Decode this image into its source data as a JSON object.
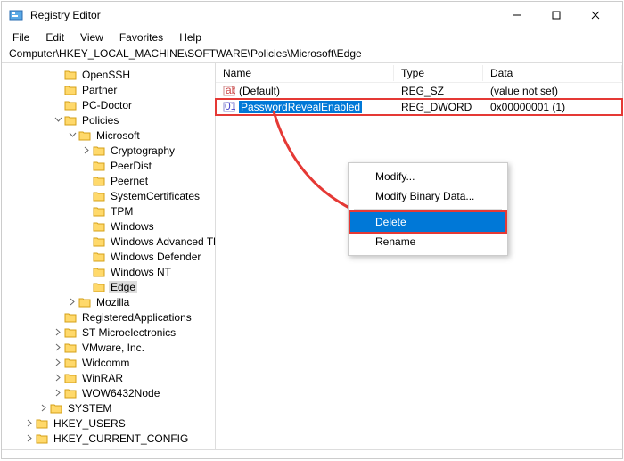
{
  "window": {
    "title": "Registry Editor"
  },
  "menu": {
    "file": "File",
    "edit": "Edit",
    "view": "View",
    "favorites": "Favorites",
    "help": "Help"
  },
  "address": "Computer\\HKEY_LOCAL_MACHINE\\SOFTWARE\\Policies\\Microsoft\\Edge",
  "tree": {
    "openssh": "OpenSSH",
    "partner": "Partner",
    "pcdoctor": "PC-Doctor",
    "policies": "Policies",
    "microsoft": "Microsoft",
    "cryptography": "Cryptography",
    "peerdist": "PeerDist",
    "peernet": "Peernet",
    "systemcertificates": "SystemCertificates",
    "tpm": "TPM",
    "windows": "Windows",
    "windows_advanced": "Windows Advanced Threat Protection",
    "windows_defender": "Windows Defender",
    "windows_nt": "Windows NT",
    "edge": "Edge",
    "mozilla": "Mozilla",
    "registeredapps": "RegisteredApplications",
    "stmicro": "ST Microelectronics",
    "vmware": "VMware, Inc.",
    "widcomm": "Widcomm",
    "winrar": "WinRAR",
    "wow64": "WOW6432Node",
    "system": "SYSTEM",
    "hkusers": "HKEY_USERS",
    "hkcurrent": "HKEY_CURRENT_CONFIG"
  },
  "list": {
    "headers": {
      "name": "Name",
      "type": "Type",
      "data": "Data"
    },
    "rows": [
      {
        "name": "(Default)",
        "type": "REG_SZ",
        "data": "(value not set)"
      },
      {
        "name": "PasswordRevealEnabled",
        "type": "REG_DWORD",
        "data": "0x00000001 (1)"
      }
    ]
  },
  "context": {
    "modify": "Modify...",
    "modify_binary": "Modify Binary Data...",
    "delete": "Delete",
    "rename": "Rename"
  }
}
